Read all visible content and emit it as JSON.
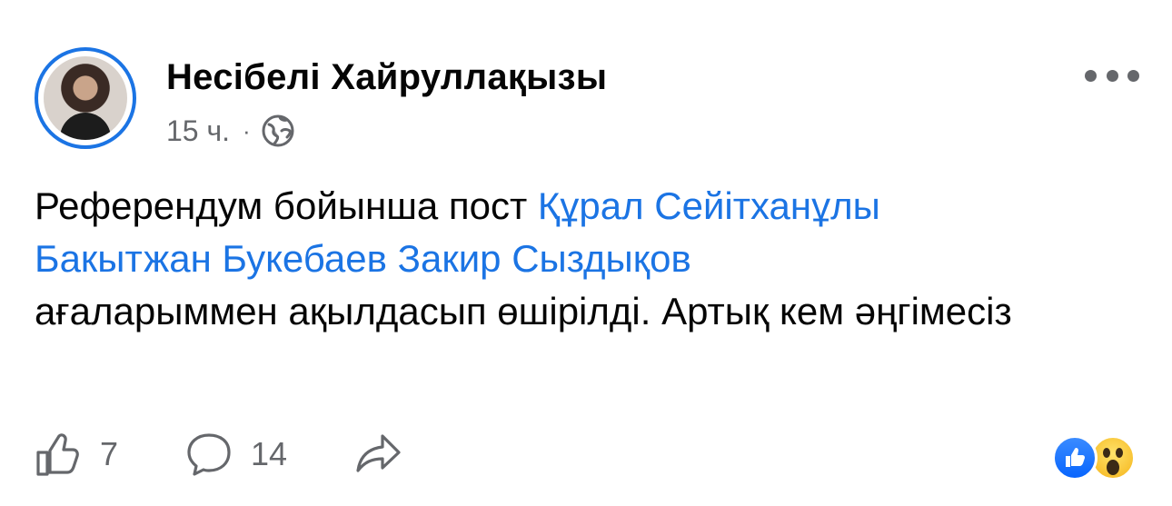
{
  "post": {
    "author": "Несібелі Хайруллақызы",
    "time": "15 ч.",
    "separator": "·",
    "privacy_icon": "globe-icon",
    "menu_icon": "more-options-icon",
    "text": {
      "prefix": "Референдум бойынша пост",
      "mentions": [
        "Құрал Сейітханұлы",
        "Бакытжан Букебаев",
        "Закир Сыздықов"
      ],
      "suffix": "ағаларыммен ақылдасып өшірілді. Артық кем әңгімесіз"
    }
  },
  "actions": {
    "like_icon": "thumbs-up-icon",
    "like_count": "7",
    "comment_icon": "comment-bubble-icon",
    "comment_count": "14",
    "share_icon": "share-arrow-icon"
  },
  "reactions": [
    "like",
    "wow"
  ],
  "colors": {
    "link": "#1b74e4",
    "meta": "#65676b",
    "text": "#050505",
    "avatar_ring": "#1b74e4"
  }
}
